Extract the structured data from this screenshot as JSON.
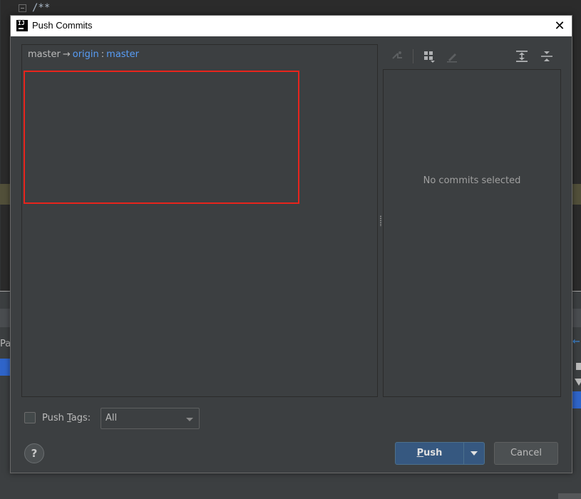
{
  "background_editor": {
    "code_text": "/**",
    "panel_text": "Pat"
  },
  "dialog": {
    "title": "Push Commits",
    "close_glyph": "✕",
    "branch": {
      "local": "master",
      "arrow": "→",
      "remote": "origin",
      "separator": ":",
      "remote_branch": "master"
    },
    "toolbar": {
      "icons": [
        "cherry-pick-icon",
        "group-by-icon",
        "edit-icon",
        "expand-all-icon",
        "collapse-all-icon"
      ]
    },
    "details": {
      "empty_text": "No commits selected"
    },
    "push_tags": {
      "checked": false,
      "label_prefix": "Push ",
      "label_mnemonic": "T",
      "label_suffix": "ags:",
      "selected": "All"
    },
    "buttons": {
      "help": "?",
      "push_mnemonic": "P",
      "push_rest": "ush",
      "cancel": "Cancel"
    },
    "colors": {
      "highlight_frame": "#e8241c",
      "remote_link": "#589df6",
      "push_button": "#365880"
    }
  }
}
